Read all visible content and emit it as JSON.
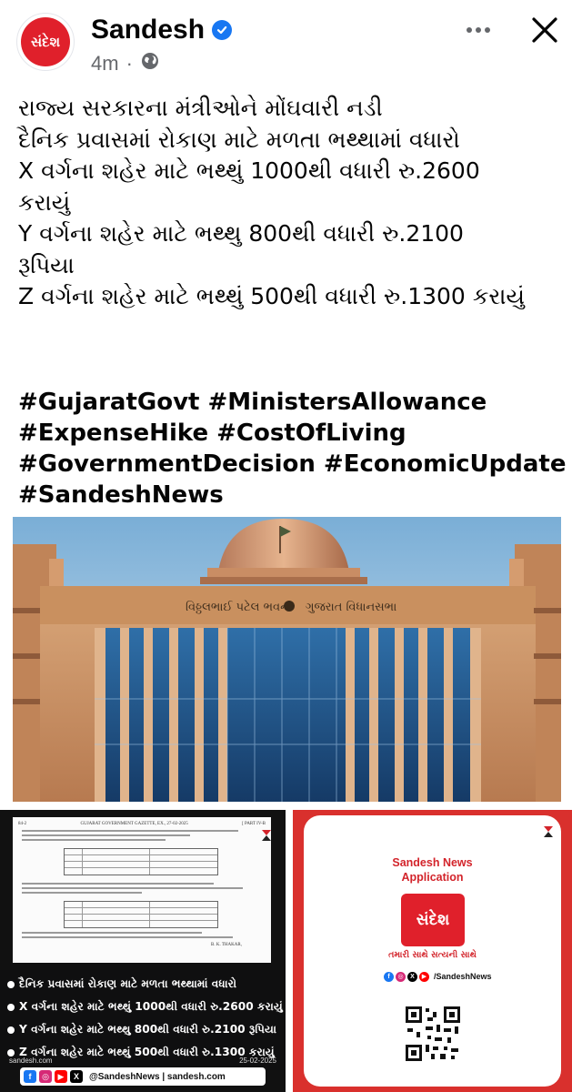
{
  "post": {
    "page_name": "Sandesh",
    "avatar_text": "સંદેશ",
    "timestamp": "4m",
    "separator": "·",
    "privacy_icon": "globe-icon",
    "verified_icon": "verified-badge-icon",
    "text_lines": [
      "રાજ્ય સરકારના મંત્રીઓને મોંઘવારી નડી",
      "દૈનિક પ્રવાસમાં રોકાણ માટે મળતા ભથ્થામાં વધારો",
      "X વર્ગના શહેર માટે ભથ્થું 1000થી વધારી રુ.2600",
      "કરાયું",
      "Y વર્ગના શહેર માટે ભથ્થુ  800થી વધારી રુ.2100",
      "રૂપિયા",
      "Z વર્ગના શહેર માટે ભથ્થું 500થી વધારી રુ.1300 કરાયું"
    ],
    "hashtag_lines": [
      "#GujaratGovt #MinistersAllowance",
      "#ExpenseHike #CostOfLiving",
      "#GovernmentDecision #EconomicUpdate",
      "#SandeshNews"
    ]
  },
  "main_image": {
    "sign_left": "વિઠ્ઠલભાઈ પટેલ ભવન",
    "sign_right": "ગુજરાત વિધાનસભા"
  },
  "thumb_left": {
    "doc_header_left": "84-2",
    "doc_header_center": "GUJARAT GOVERNMENT GAZETTE, EX., 27-02-2025",
    "doc_header_right": "[ PART IV-B",
    "doc_signature_name": "B. K. THAKAR,",
    "bullets": [
      "દૈનિક પ્રવાસમાં રોકાણ માટે મળતા ભથ્થામાં વધારો",
      "X વર્ગના શહેર માટે ભથ્થું 1000થી વધારી રુ.2600 કરાયું",
      "Y વર્ગના શહેર માટે ભથ્થુ  800થી વધારી રુ.2100 રૂપિયા",
      "Z વર્ગના શહેર માટે ભથ્થું 500થી વધારી રુ.1300 કરાયું"
    ],
    "site": "sandesh.com",
    "date": "25-02-2025",
    "social_text": "@SandeshNews | sandesh.com"
  },
  "thumb_right": {
    "app_title_line1": "Sandesh News",
    "app_title_line2": "Application",
    "logo_text": "સંદેશ",
    "tagline": "તમારી સાથે સત્યની સાથે",
    "social_text": "/SandeshNews",
    "qr_icon": "qr-code-icon"
  },
  "colors": {
    "brand_red": "#e0202b",
    "verified_blue": "#1877f2",
    "meta_gray": "#65676b"
  }
}
